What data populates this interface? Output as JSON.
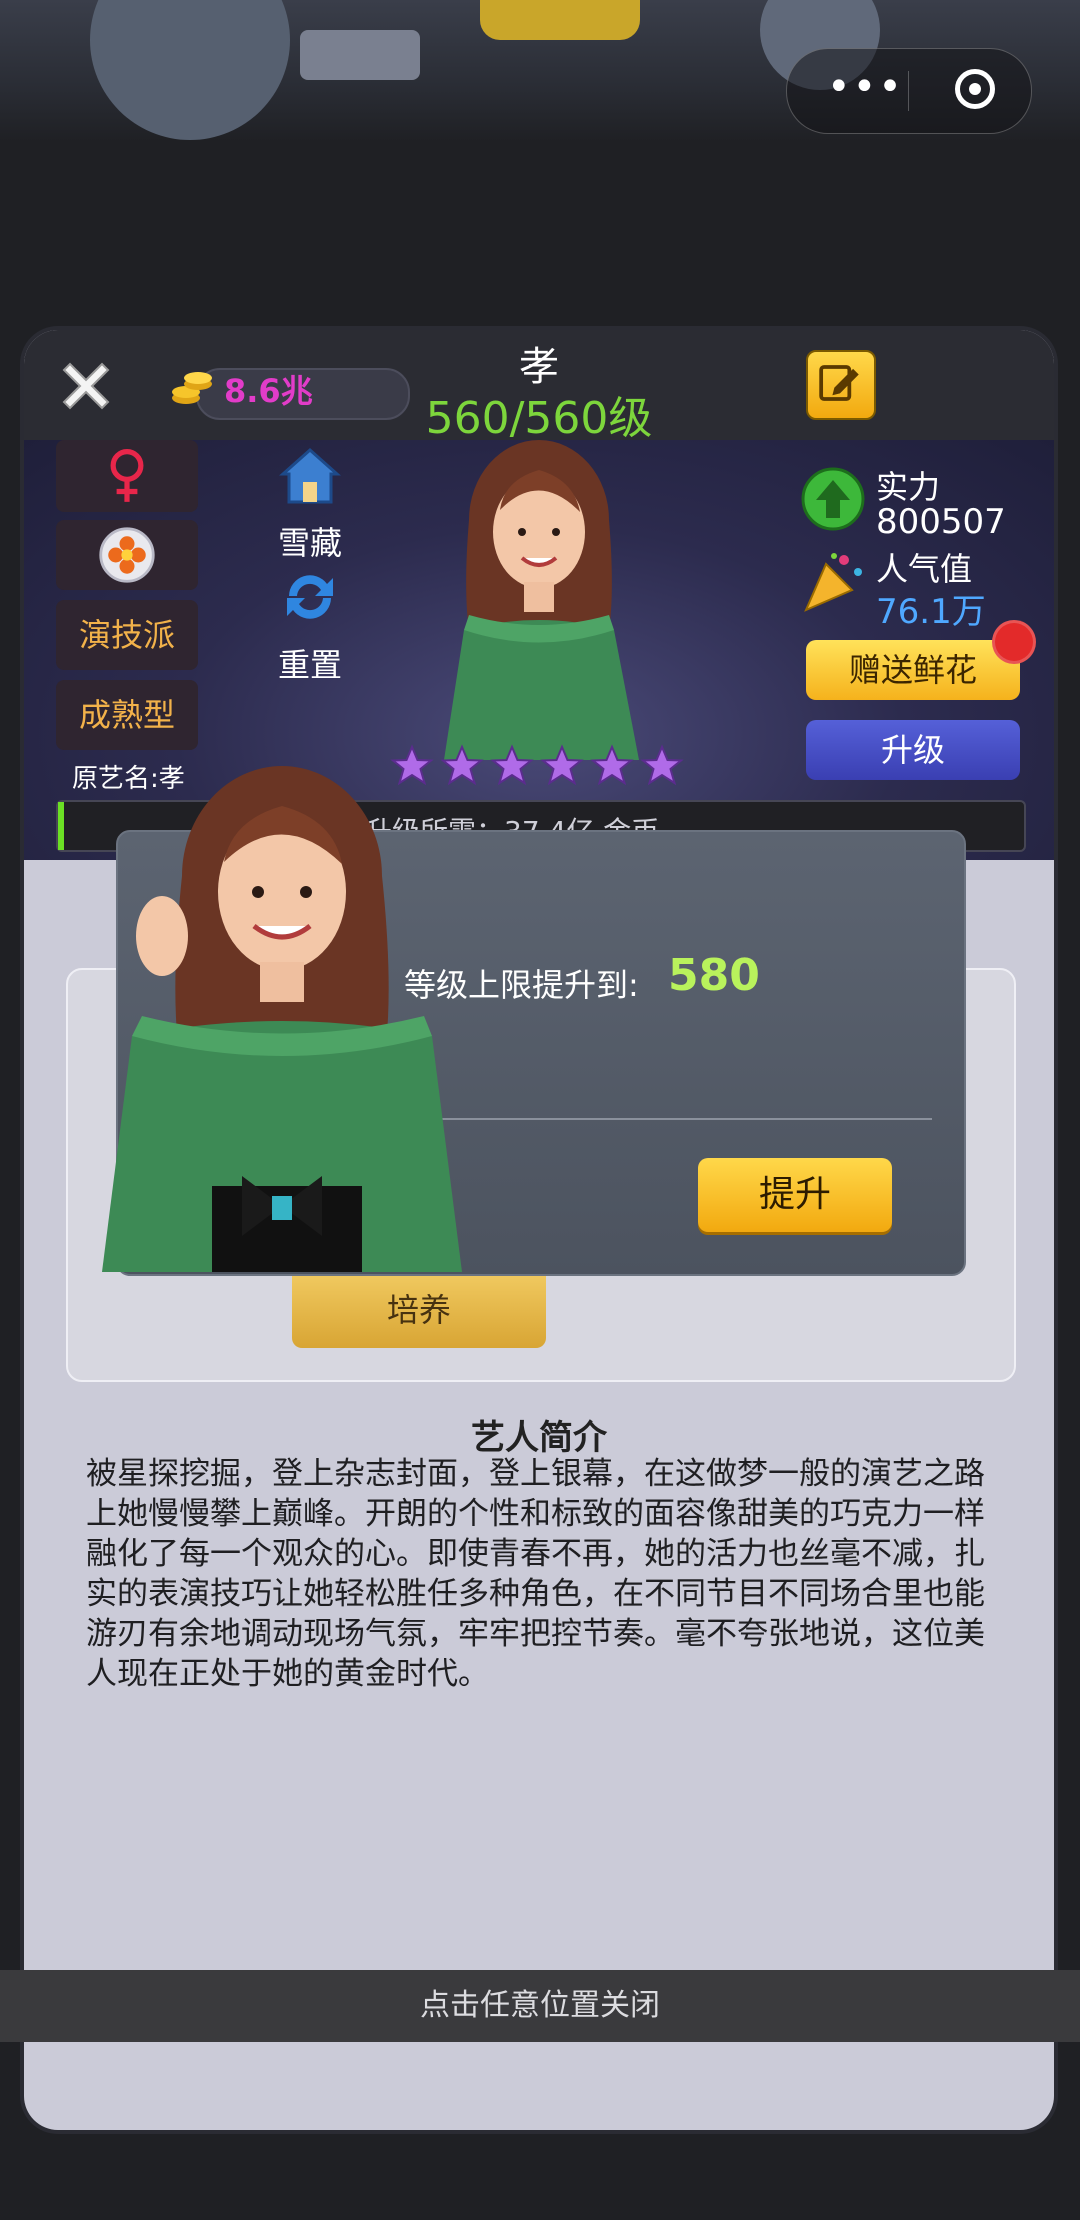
{
  "header": {
    "hero_name": "孝",
    "level": "560/560级",
    "gold": "8.6兆"
  },
  "side_tags": [
    "演技派",
    "成熟型"
  ],
  "original_name": "原艺名:孝",
  "upgrade_cost": "升级所需：37.4亿 金币",
  "tools": {
    "collect": "雪藏",
    "reset": "重置"
  },
  "stats": {
    "power_label": "实力",
    "power_value": "800507",
    "popularity_label": "人气值",
    "popularity_value": "76.1万"
  },
  "buttons": {
    "gift": "赠送鲜花",
    "upgrade": "升级",
    "train": "培养",
    "confirm": "提升"
  },
  "stars": 6,
  "dialog": {
    "label": "等级上限提升到:",
    "value": "580"
  },
  "intro": {
    "title": "艺人简介",
    "text": "被星探挖掘，登上杂志封面，登上银幕，在这做梦一般的演艺之路上她慢慢攀上巅峰。开朗的个性和标致的面容像甜美的巧克力一样融化了每一个观众的心。即使青春不再，她的活力也丝毫不减，扎实的表演技巧让她轻松胜任多种角色，在不同节目不同场合里也能游刃有余地调动现场气氛，牢牢把控节奏。毫不夸张地说，这位美人现在正处于她的黄金时代。"
  },
  "footer": "点击任意位置关闭",
  "colors": {
    "level": "#7dd63c",
    "gold": "#e23cc9",
    "dialog_value": "#b9f25c",
    "gold_button": "#f5b21c",
    "upgrade_button": "#3a3fb2"
  }
}
